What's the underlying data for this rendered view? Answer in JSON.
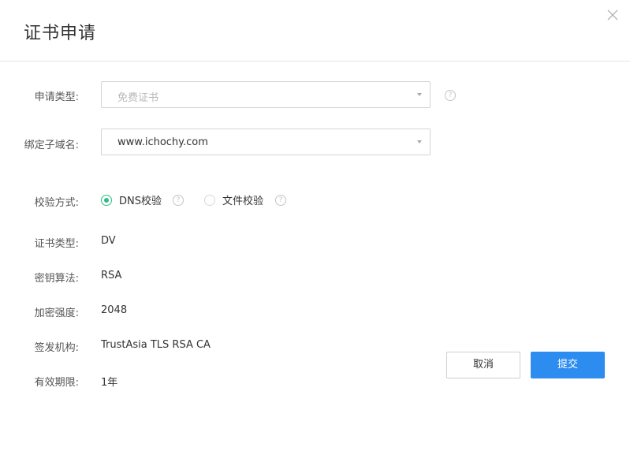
{
  "dialog": {
    "title": "证书申请"
  },
  "form": {
    "type": {
      "label": "申请类型:",
      "value": "免费证书"
    },
    "subdomain": {
      "label": "绑定子域名:",
      "value": "www.ichochy.com"
    },
    "verification": {
      "label": "校验方式:",
      "options": [
        {
          "label": "DNS校验",
          "checked": true
        },
        {
          "label": "文件校验",
          "checked": false
        }
      ]
    },
    "info": [
      {
        "label": "证书类型:",
        "value": "DV"
      },
      {
        "label": "密钥算法:",
        "value": "RSA"
      },
      {
        "label": "加密强度:",
        "value": "2048"
      },
      {
        "label": "签发机构:",
        "value": "TrustAsia TLS RSA CA"
      },
      {
        "label": "有效期限:",
        "value": "1年"
      }
    ]
  },
  "buttons": {
    "cancel": "取消",
    "submit": "提交"
  },
  "help_glyph": "?",
  "colors": {
    "primary": "#2d8cf0",
    "radio_checked": "#2ebd86"
  },
  "icons": {
    "close": "close-icon",
    "help": "question-circle-icon",
    "dropdown": "caret-down-icon"
  }
}
